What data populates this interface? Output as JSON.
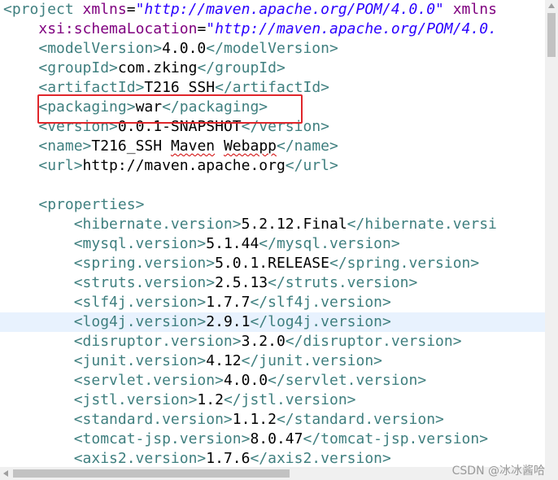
{
  "editor": {
    "lines": [
      {
        "indent": "",
        "parts": [
          [
            "tag",
            "<project "
          ],
          [
            "attr",
            "xmlns"
          ],
          [
            "txt",
            "="
          ],
          [
            "val",
            "\"http://maven.apache.org/POM/4.0.0\""
          ],
          [
            "txt",
            " "
          ],
          [
            "attr",
            "xmlns"
          ]
        ]
      },
      {
        "indent": "    ",
        "parts": [
          [
            "attr",
            "xsi:schemaLocation"
          ],
          [
            "txt",
            "="
          ],
          [
            "val",
            "\"http://maven.apache.org/POM/4.0."
          ]
        ]
      },
      {
        "indent": "    ",
        "parts": [
          [
            "tag",
            "<modelVersion>"
          ],
          [
            "txt",
            "4.0.0"
          ],
          [
            "tag",
            "</modelVersion>"
          ]
        ]
      },
      {
        "indent": "    ",
        "parts": [
          [
            "tag",
            "<groupId>"
          ],
          [
            "txt",
            "com.zking"
          ],
          [
            "tag",
            "</groupId>"
          ]
        ]
      },
      {
        "indent": "    ",
        "parts": [
          [
            "tag",
            "<artifactId>"
          ],
          [
            "txt",
            "T216_SSH"
          ],
          [
            "tag",
            "</artifactId>"
          ]
        ]
      },
      {
        "indent": "    ",
        "parts": [
          [
            "tag",
            "<packaging>"
          ],
          [
            "txt",
            "war"
          ],
          [
            "tag",
            "</packaging>"
          ]
        ]
      },
      {
        "indent": "    ",
        "parts": [
          [
            "tag",
            "<version>"
          ],
          [
            "txt",
            "0.0.1-SNAPSHOT"
          ],
          [
            "tag",
            "</version>"
          ]
        ]
      },
      {
        "indent": "    ",
        "parts": [
          [
            "tag",
            "<name>"
          ],
          [
            "txt",
            "T216_SSH Maven Webapp"
          ],
          [
            "tag",
            "</name>"
          ]
        ]
      },
      {
        "indent": "    ",
        "parts": [
          [
            "tag",
            "<url>"
          ],
          [
            "txt",
            "http://maven.apache.org"
          ],
          [
            "tag",
            "</url>"
          ]
        ]
      },
      {
        "indent": "",
        "parts": []
      },
      {
        "indent": "    ",
        "parts": [
          [
            "tag",
            "<properties>"
          ]
        ]
      },
      {
        "indent": "        ",
        "parts": [
          [
            "tag",
            "<hibernate.version>"
          ],
          [
            "txt",
            "5.2.12.Final"
          ],
          [
            "tag",
            "</hibernate.versi"
          ]
        ]
      },
      {
        "indent": "        ",
        "parts": [
          [
            "tag",
            "<mysql.version>"
          ],
          [
            "txt",
            "5.1.44"
          ],
          [
            "tag",
            "</mysql.version>"
          ]
        ]
      },
      {
        "indent": "        ",
        "parts": [
          [
            "tag",
            "<spring.version>"
          ],
          [
            "txt",
            "5.0.1.RELEASE"
          ],
          [
            "tag",
            "</spring.version>"
          ]
        ]
      },
      {
        "indent": "        ",
        "parts": [
          [
            "tag",
            "<struts.version>"
          ],
          [
            "txt",
            "2.5.13"
          ],
          [
            "tag",
            "</struts.version>"
          ]
        ]
      },
      {
        "indent": "        ",
        "parts": [
          [
            "tag",
            "<slf4j.version>"
          ],
          [
            "txt",
            "1.7.7"
          ],
          [
            "tag",
            "</slf4j.version>"
          ]
        ]
      },
      {
        "indent": "        ",
        "parts": [
          [
            "tag",
            "<log4j.version>"
          ],
          [
            "txt",
            "2.9.1"
          ],
          [
            "tag",
            "</log4j.version>"
          ]
        ]
      },
      {
        "indent": "        ",
        "parts": [
          [
            "tag",
            "<disruptor.version>"
          ],
          [
            "txt",
            "3.2.0"
          ],
          [
            "tag",
            "</disruptor.version>"
          ]
        ]
      },
      {
        "indent": "        ",
        "parts": [
          [
            "tag",
            "<junit.version>"
          ],
          [
            "txt",
            "4.12"
          ],
          [
            "tag",
            "</junit.version>"
          ]
        ]
      },
      {
        "indent": "        ",
        "parts": [
          [
            "tag",
            "<servlet.version>"
          ],
          [
            "txt",
            "4.0.0"
          ],
          [
            "tag",
            "</servlet.version>"
          ]
        ]
      },
      {
        "indent": "        ",
        "parts": [
          [
            "tag",
            "<jstl.version>"
          ],
          [
            "txt",
            "1.2"
          ],
          [
            "tag",
            "</jstl.version>"
          ]
        ]
      },
      {
        "indent": "        ",
        "parts": [
          [
            "tag",
            "<standard.version>"
          ],
          [
            "txt",
            "1.1.2"
          ],
          [
            "tag",
            "</standard.version>"
          ]
        ]
      },
      {
        "indent": "        ",
        "parts": [
          [
            "tag",
            "<tomcat-jsp.version>"
          ],
          [
            "txt",
            "8.0.47"
          ],
          [
            "tag",
            "</tomcat-jsp.version>"
          ]
        ]
      },
      {
        "indent": "        ",
        "parts": [
          [
            "tag",
            "<axis2.version>"
          ],
          [
            "txt",
            "1.7.6"
          ],
          [
            "tag",
            "</axis2.version>"
          ]
        ]
      }
    ],
    "highlighted_line": 16,
    "boxed_line": 5,
    "spellcheck_line": 7,
    "spellcheck_words": [
      "Maven",
      "Webapp"
    ]
  },
  "watermark": "CSDN @冰冰酱哈",
  "colors": {
    "tag": "#3f7f7f",
    "attribute": "#7f007f",
    "string": "#2a00ff",
    "text": "#000000",
    "current_line": "#e8f2fe",
    "annotation_box": "#e0262b"
  }
}
